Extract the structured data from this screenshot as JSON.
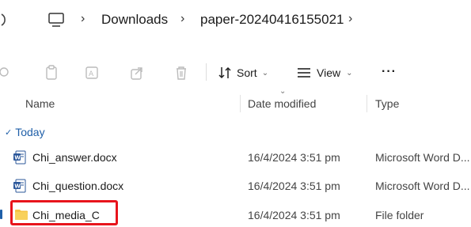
{
  "address_bar": {
    "crumbs": [
      "Downloads",
      "paper-20240416155021"
    ],
    "separator": "›"
  },
  "toolbar": {
    "sort_label": "Sort",
    "view_label": "View",
    "more_label": "···"
  },
  "columns": {
    "name": "Name",
    "date_modified": "Date modified",
    "type": "Type"
  },
  "group": {
    "label": "Today"
  },
  "files": [
    {
      "name": "Chi_answer.docx",
      "date": "16/4/2024 3:51 pm",
      "type": "Microsoft Word D...",
      "icon": "word-doc-icon"
    },
    {
      "name": "Chi_question.docx",
      "date": "16/4/2024 3:51 pm",
      "type": "Microsoft Word D...",
      "icon": "word-doc-icon"
    },
    {
      "name": "Chi_media_C",
      "date": "16/4/2024 3:51 pm",
      "type": "File folder",
      "icon": "folder-icon"
    }
  ],
  "colors": {
    "highlight": "#e8141c",
    "folder": "#f6c343",
    "word": "#2b579a",
    "group_label": "#1f5fa8"
  }
}
